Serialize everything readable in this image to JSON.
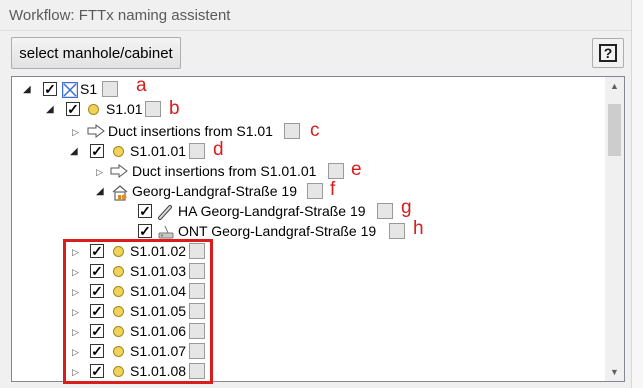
{
  "window": {
    "title": "Workflow: FTTx naming assistent"
  },
  "toolbar": {
    "select_label": "select manhole/cabinet",
    "help_label": "?"
  },
  "colors": {
    "annotation": "#d91c1c",
    "node_dot": "#f2d35a",
    "cabinet_icon": "#3b6fd6"
  },
  "tree": {
    "s1": "S1",
    "s1_01": "S1.01",
    "duct_s1_01": "Duct insertions from S1.01",
    "s1_01_01": "S1.01.01",
    "duct_s1_01_01": "Duct insertions from S1.01.01",
    "address": "Georg-Landgraf-Straße 19",
    "ha": "HA Georg-Landgraf-Straße 19",
    "ont": "ONT Georg-Landgraf-Straße 19",
    "children": [
      "S1.01.02",
      "S1.01.03",
      "S1.01.04",
      "S1.01.05",
      "S1.01.06",
      "S1.01.07",
      "S1.01.08"
    ]
  },
  "annotations": {
    "a": "a",
    "b": "b",
    "c": "c",
    "d": "d",
    "e": "e",
    "f": "f",
    "g": "g",
    "h": "h"
  },
  "icons": {
    "cabinet": "cabinet-icon",
    "node": "node-dot-icon",
    "duct": "arrow-right-icon",
    "house": "house-icon",
    "ha": "cable-icon",
    "ont": "ont-device-icon",
    "help": "help-icon"
  }
}
